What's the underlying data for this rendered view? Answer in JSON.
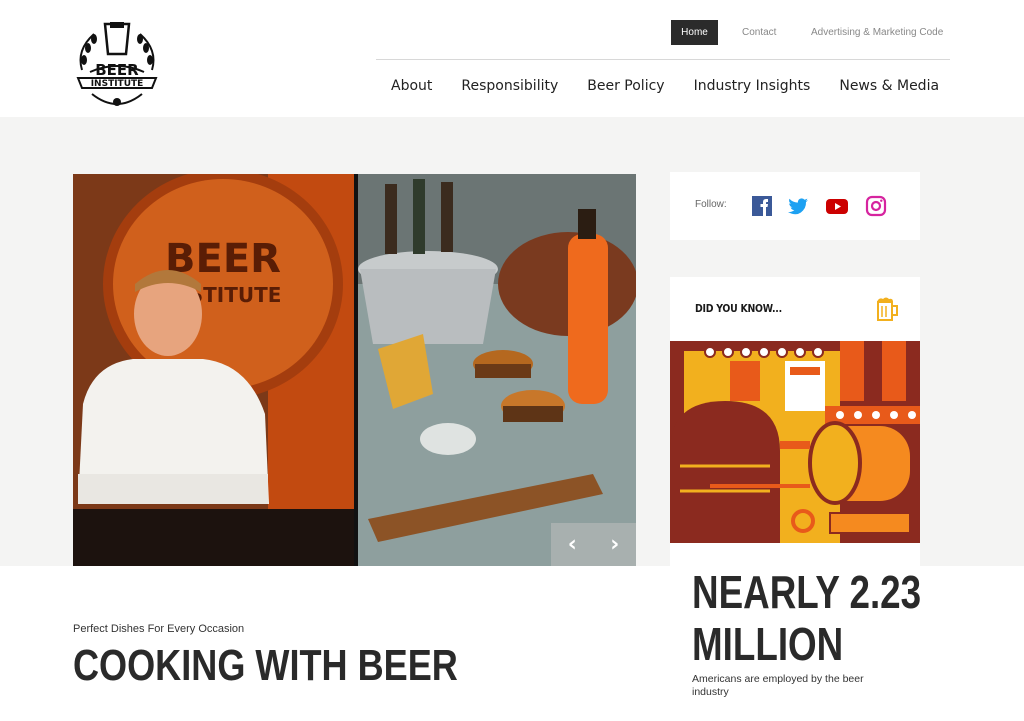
{
  "header": {
    "logo_text_top": "BEER",
    "logo_text_bottom": "INSTITUTE",
    "top_links": {
      "home": "Home",
      "contact": "Contact",
      "ad_code": "Advertising & Marketing Code"
    },
    "main_nav": [
      "About",
      "Responsibility",
      "Beer Policy",
      "Industry Insights",
      "News & Media"
    ]
  },
  "hero": {
    "sign_text_top": "BEER",
    "sign_text_bottom": "INSTITUTE",
    "prev": "‹",
    "next": "›"
  },
  "social": {
    "label": "Follow:",
    "icons": [
      "facebook-icon",
      "twitter-icon",
      "youtube-icon",
      "instagram-icon"
    ],
    "colors": {
      "facebook": "#3b5998",
      "twitter": "#1da1f2",
      "youtube": "#cc0000",
      "instagram": "#d6249f"
    }
  },
  "did_you_know": {
    "title": "DID YOU KNOW...",
    "icon": "beer-mug-icon",
    "accent": "#f2b01e"
  },
  "feature": {
    "kicker": "Perfect Dishes For Every Occasion",
    "headline": "COOKING WITH BEER"
  },
  "stat": {
    "value": "NEARLY 2.23 MILLION",
    "description": "Americans are employed by the beer industry"
  }
}
